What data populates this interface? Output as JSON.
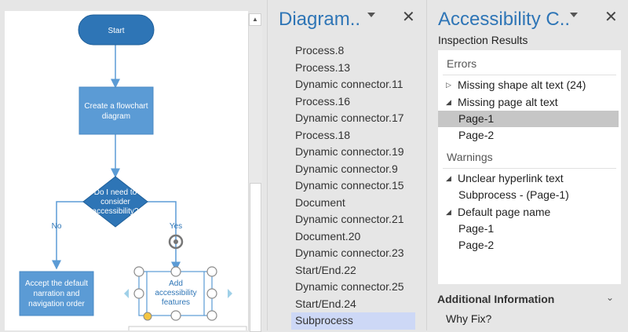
{
  "canvas": {
    "nodes": {
      "start": "Start",
      "create": [
        "Create a flowchart",
        "diagram"
      ],
      "decision": [
        "Do I need to",
        "consider",
        "accessibility?"
      ],
      "accept": [
        "Accept the default",
        "narration and",
        "navigation order"
      ],
      "add": [
        "Add",
        "accessibility",
        "features"
      ]
    },
    "edges": {
      "no": "No",
      "yes": "Yes"
    },
    "scroll_up_icon": "triangle-up-icon"
  },
  "diagram_pane": {
    "title": "Diagram..",
    "items": [
      "Process.8",
      "Process.13",
      "Dynamic connector.11",
      "Process.16",
      "Dynamic connector.17",
      "Process.18",
      "Dynamic connector.19",
      "Dynamic connector.9",
      "Dynamic connector.15",
      "Document",
      "Dynamic connector.21",
      "Document.20",
      "Dynamic connector.23",
      "Start/End.22",
      "Dynamic connector.25",
      "Start/End.24",
      "Subprocess"
    ],
    "selected_item": "Subprocess",
    "close_glyph": "✕"
  },
  "accessibility_pane": {
    "title": "Accessibility C..",
    "close_glyph": "✕",
    "inspection_label": "Inspection Results",
    "errors": {
      "header": "Errors",
      "missing_shape": "Missing shape alt text (24)",
      "missing_page": "Missing page alt text",
      "pages": [
        "Page-1",
        "Page-2"
      ],
      "selected_page": "Page-1"
    },
    "warnings": {
      "header": "Warnings",
      "unclear": "Unclear hyperlink text",
      "unclear_child": "Subprocess -  (Page-1)",
      "default_name": "Default page name",
      "pages": [
        "Page-1",
        "Page-2"
      ]
    },
    "additional": {
      "header": "Additional Information",
      "why_fix": "Why Fix?"
    }
  },
  "colors": {
    "shape_fill": "#5b9bd5",
    "shape_dark": "#2e75b6",
    "accent_text": "#2e75b6",
    "selection_blue": "#cdd8f6",
    "selection_gray": "#c6c6c6"
  }
}
